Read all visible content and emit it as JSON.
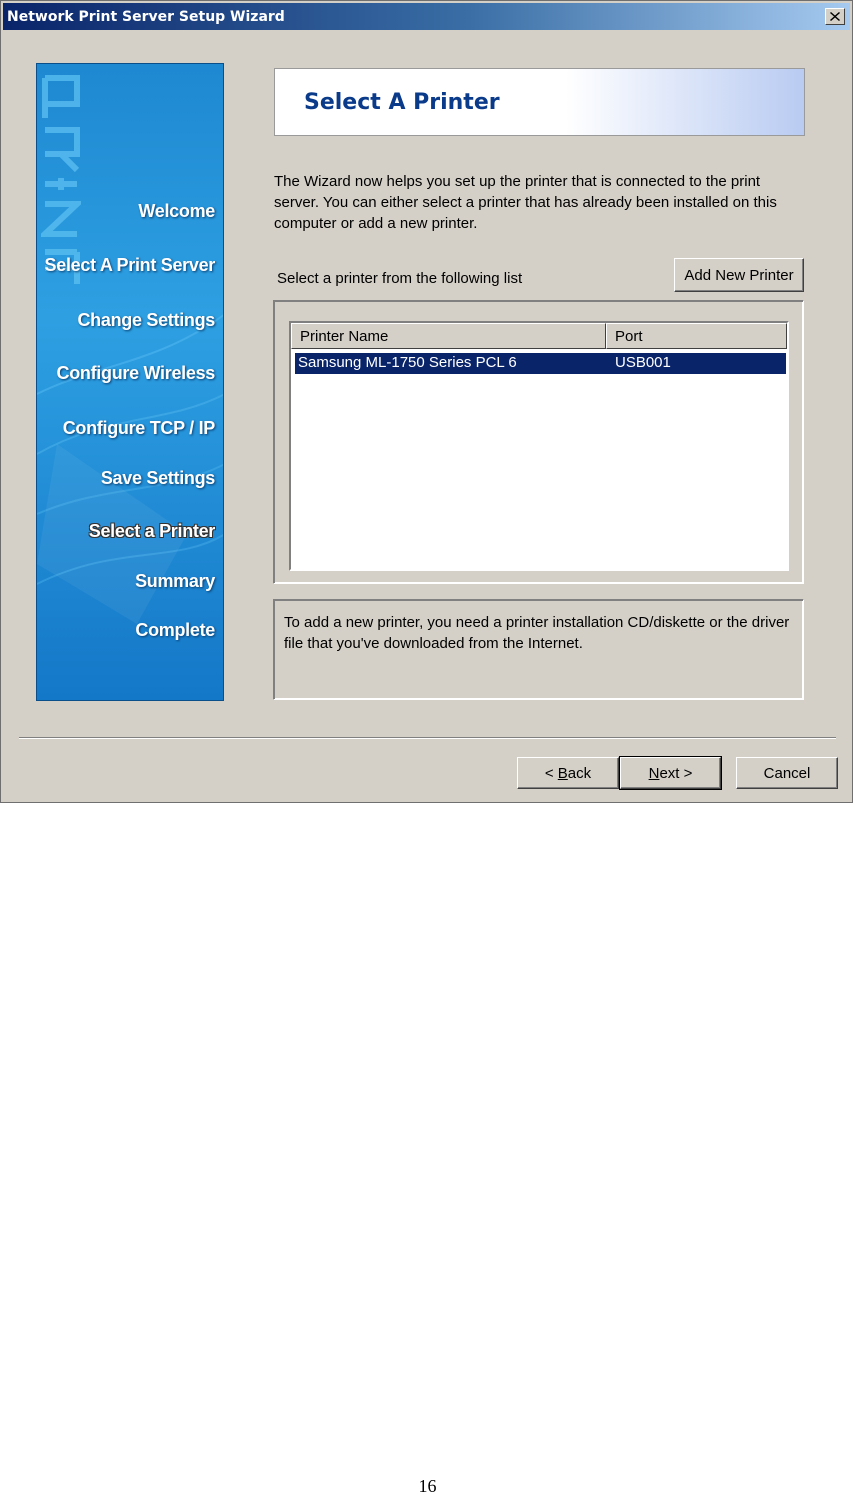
{
  "window": {
    "title": "Network Print Server Setup Wizard"
  },
  "sidebar": {
    "steps": [
      {
        "label": "Welcome",
        "active": false
      },
      {
        "label": "Select A Print Server",
        "active": false
      },
      {
        "label": "Change Settings",
        "active": false
      },
      {
        "label": "Configure Wireless",
        "active": false
      },
      {
        "label": "Configure TCP / IP",
        "active": false
      },
      {
        "label": "Save Settings",
        "active": false
      },
      {
        "label": "Select a Printer",
        "active": true
      },
      {
        "label": "Summary",
        "active": false
      },
      {
        "label": "Complete",
        "active": false
      }
    ],
    "watermark_icon": "print-watermark-icon"
  },
  "header": {
    "title": "Select A Printer"
  },
  "description": "The Wizard now helps you set up the printer that is connected to the print server. You can either select a printer that has already been installed on this computer or add a new printer.",
  "printer_list": {
    "label": "Select a printer from the following list",
    "add_button": "Add New Printer",
    "columns": [
      "Printer Name",
      "Port"
    ],
    "rows": [
      {
        "name": "Samsung ML-1750 Series PCL 6",
        "port": "USB001",
        "selected": true
      }
    ]
  },
  "info": "To add a new printer, you need a printer installation CD/diskette or the driver file that you've downloaded from the Internet.",
  "buttons": {
    "back_prefix": "< ",
    "back_accel": "B",
    "back_rest": "ack",
    "next_accel": "N",
    "next_rest": "ext",
    "next_suffix": " >",
    "cancel": "Cancel"
  },
  "page_number": "16",
  "colors": {
    "titlebar": "#0a246a",
    "sidebar": "#1e88d1",
    "selection": "#0a246a",
    "dialog": "#d4d0c8",
    "header_title": "#0a3a8a"
  }
}
